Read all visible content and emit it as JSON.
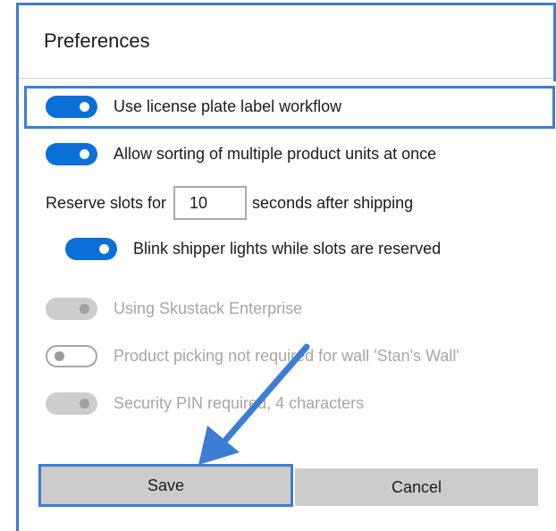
{
  "dialog": {
    "title": "Preferences"
  },
  "settings": {
    "license_plate": {
      "label": "Use license plate label workflow",
      "state": "on"
    },
    "multi_sort": {
      "label": "Allow sorting of multiple product units at once",
      "state": "on"
    },
    "reserve": {
      "prefix": "Reserve slots for",
      "value": "10",
      "suffix": "seconds after shipping"
    },
    "blink_lights": {
      "label": "Blink shipper lights while slots are reserved",
      "state": "on"
    },
    "skustack": {
      "label": "Using Skustack Enterprise",
      "state": "on-disabled"
    },
    "product_picking": {
      "label": "Product picking not required for wall 'Stan's Wall'",
      "state": "off-disabled"
    },
    "security_pin": {
      "label": "Security PIN required, 4 characters",
      "state": "on-disabled"
    }
  },
  "buttons": {
    "save": "Save",
    "cancel": "Cancel"
  },
  "colors": {
    "accent": "#0a6fd6",
    "annotation": "#3d7dd6",
    "disabled": "#a6a6a6",
    "button_bg": "#cccccc"
  },
  "annotations": {
    "arrow": "arrow pointing to Save button"
  }
}
